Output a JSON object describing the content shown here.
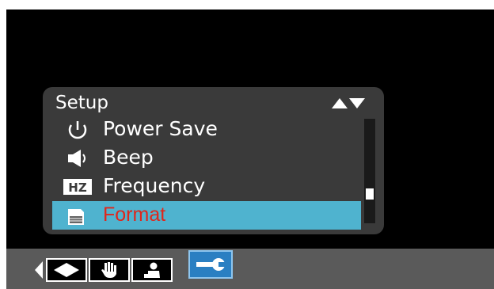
{
  "menu": {
    "title": "Setup",
    "items": [
      {
        "label": "Power Save",
        "icon": "power-icon"
      },
      {
        "label": "Beep",
        "icon": "speaker-icon"
      },
      {
        "label": "Frequency",
        "icon": "hz-icon",
        "icon_text": "HZ"
      },
      {
        "label": "Format",
        "icon": "memory-card-icon",
        "selected": true
      }
    ]
  },
  "modebar": {
    "tabs": [
      {
        "name": "scene-mode",
        "icon": "diamond-icon"
      },
      {
        "name": "hand-mode",
        "icon": "hand-icon"
      },
      {
        "name": "person-mode",
        "icon": "person-icon"
      },
      {
        "name": "setup-mode",
        "icon": "wrench-icon",
        "active": true
      }
    ]
  },
  "colors": {
    "highlight": "#4fb3cf",
    "selected_text": "#e0261b",
    "active_tab": "#2a7fc2"
  }
}
